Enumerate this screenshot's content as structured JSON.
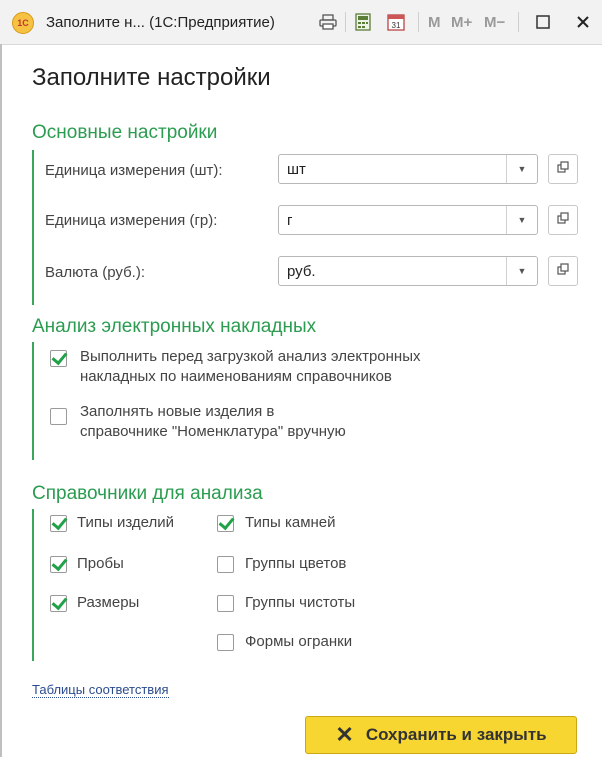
{
  "window": {
    "title": "Заполните н...  (1С:Предприятие)",
    "logo_text": "1С",
    "toolbar": {
      "m": "M",
      "m_plus": "M+",
      "m_minus": "M−"
    }
  },
  "form": {
    "title": "Заполните настройки"
  },
  "basic": {
    "title": "Основные настройки",
    "fields": [
      {
        "label": "Единица измерения (шт):",
        "value": "шт"
      },
      {
        "label": "Единица измерения (гр):",
        "value": "г"
      },
      {
        "label": "Валюта (руб.):",
        "value": "руб."
      }
    ]
  },
  "analysis": {
    "title": "Анализ электронных накладных",
    "options": [
      {
        "line1": "Выполнить перед загрузкой анализ электронных",
        "line2": "накладных по наименованиям справочников",
        "checked": true
      },
      {
        "line1": "Заполнять новые изделия в",
        "line2": "справочнике \"Номенклатура\" вручную",
        "checked": false
      }
    ]
  },
  "catalogs": {
    "title": "Справочники для анализа",
    "items": [
      {
        "label": "Типы изделий",
        "checked": true
      },
      {
        "label": "Пробы",
        "checked": true
      },
      {
        "label": "Размеры",
        "checked": true
      },
      {
        "label": "Типы камней",
        "checked": true
      },
      {
        "label": "Группы цветов",
        "checked": false
      },
      {
        "label": "Группы чистоты",
        "checked": false
      },
      {
        "label": "Формы огранки",
        "checked": false
      }
    ]
  },
  "link": {
    "label": "Таблицы соответствия"
  },
  "footer": {
    "save_label": "Сохранить и закрыть"
  }
}
